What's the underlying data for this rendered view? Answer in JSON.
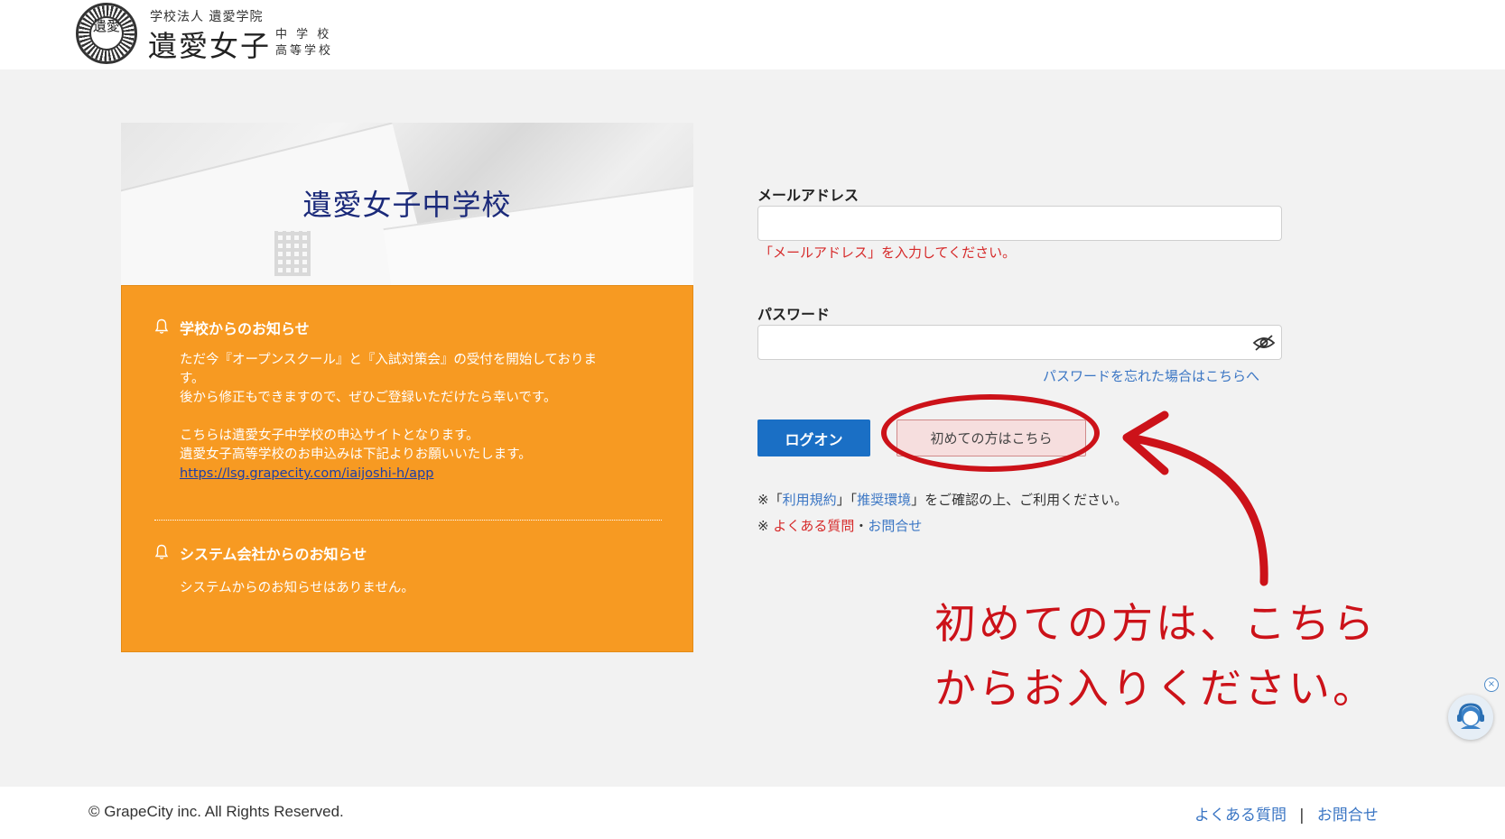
{
  "header": {
    "logo_seal_text": "遺愛",
    "logo_corp": "学校法人 遺愛学院",
    "logo_name": "遺愛女子",
    "logo_level_1": "中 学 校",
    "logo_level_2": "高等学校"
  },
  "banner": {
    "title": "遺愛女子中学校"
  },
  "notice": {
    "school": {
      "title": "学校からのお知らせ",
      "lines": [
        "ただ今『オープンスクール』と『入試対策会』の受付を開始しておりま",
        "す。",
        "後から修正もできますので、ぜひご登録いただけたら幸いです。",
        "",
        "こちらは遺愛女子中学校の申込サイトとなります。",
        "遺愛女子高等学校のお申込みは下記よりお願いいたします。"
      ],
      "link": "https://lsg.grapecity.com/iaijoshi-h/app"
    },
    "system": {
      "title": "システム会社からのお知らせ",
      "body": "システムからのお知らせはありません。"
    }
  },
  "form": {
    "email_label": "メールアドレス",
    "email_value": "",
    "email_error": "「メールアドレス」を入力してください。",
    "password_label": "パスワード",
    "password_value": "",
    "forgot_link": "パスワードを忘れた場合はこちらへ",
    "login_button": "ログオン",
    "first_time_button": "初めての方はこちら",
    "note1_prefix": "※「",
    "note1_terms": "利用規約",
    "note1_mid": "」「",
    "note1_env": "推奨環境",
    "note1_suffix": "」をご確認の上、ご利用ください。",
    "note2_prefix": "※ ",
    "note2_faq": "よくある質問",
    "note2_dot": "・",
    "note2_contact": "お問合せ"
  },
  "annotation": {
    "line1": "初めての方は、こちら",
    "line2": "からお入りください。",
    "color": "#cc1219"
  },
  "support_widget": {
    "close": "×"
  },
  "footer": {
    "copyright": "© GrapeCity inc. All Rights Reserved.",
    "faq": "よくある質問",
    "separator": "|",
    "contact": "お問合せ"
  }
}
